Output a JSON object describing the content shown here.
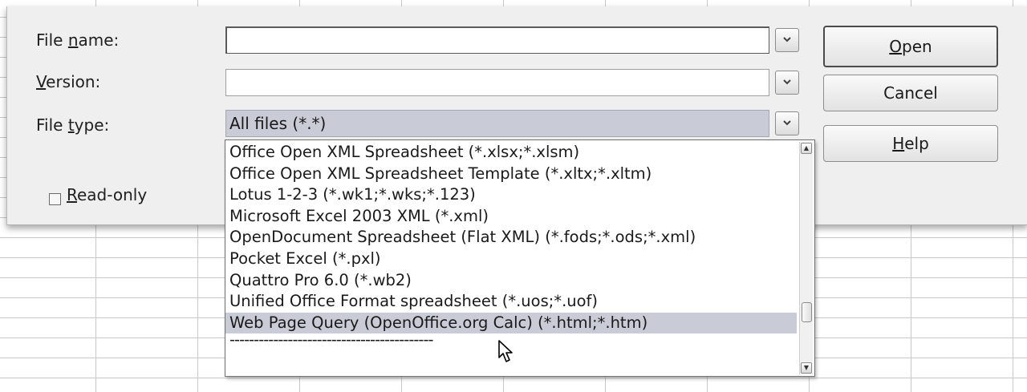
{
  "dialog": {
    "labels": {
      "file_name": {
        "pre": "File ",
        "key": "n",
        "post": "ame:"
      },
      "version": {
        "pre": "",
        "key": "V",
        "post": "ersion:"
      },
      "file_type": {
        "pre": "File ",
        "key": "t",
        "post": "ype:"
      }
    },
    "file_name_value": "",
    "version_value": "",
    "file_type_value": "All files (*.*)",
    "read_only": {
      "pre": "",
      "key": "R",
      "post": "ead-only",
      "checked": false
    },
    "buttons": {
      "open": {
        "pre": "",
        "key": "O",
        "post": "pen"
      },
      "cancel": "Cancel",
      "help": {
        "pre": "",
        "key": "H",
        "post": "elp"
      }
    }
  },
  "file_type_list": {
    "items": [
      "Office Open XML Spreadsheet (*.xlsx;*.xlsm)",
      "Office Open XML Spreadsheet Template (*.xltx;*.xltm)",
      "Lotus 1-2-3 (*.wk1;*.wks;*.123)",
      "Microsoft Excel 2003 XML (*.xml)",
      "OpenDocument Spreadsheet (Flat XML) (*.fods;*.ods;*.xml)",
      "Pocket Excel (*.pxl)",
      "Quattro Pro 6.0 (*.wb2)",
      "Unified Office Format spreadsheet (*.uos;*.uof)",
      "Web Page Query (OpenOffice.org Calc) (*.html;*.htm)",
      "------------------------------------------"
    ],
    "selected_index": 8
  },
  "icons": {
    "dropdown_arrow": "chevron-down-icon",
    "scroll_up": "scroll-up-arrow-icon",
    "scroll_down": "scroll-down-arrow-icon",
    "cursor": "mouse-pointer-icon"
  },
  "colors": {
    "selection": "#c9ccd6",
    "dialog_bg": "#efefef"
  }
}
